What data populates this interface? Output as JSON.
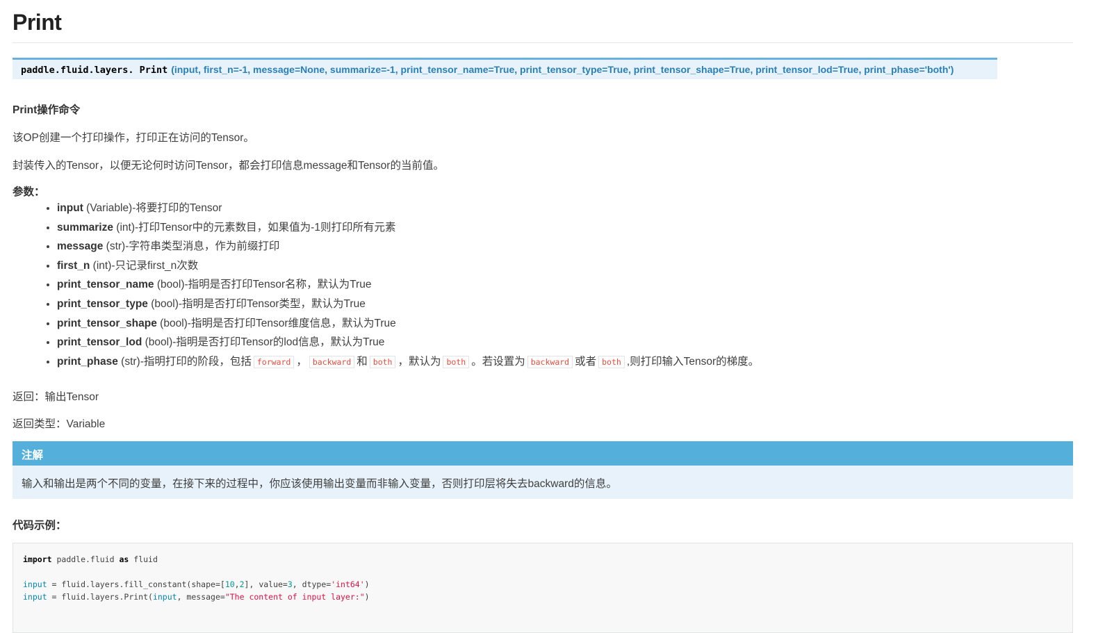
{
  "title": "Print",
  "signature": {
    "module": "paddle.fluid.layers.",
    "function": "Print",
    "params": "(input, first_n=-1, message=None, summarize=-1, print_tensor_name=True, print_tensor_type=True, print_tensor_shape=True, print_tensor_lod=True, print_phase='both')"
  },
  "heading": "Print操作命令",
  "desc1": "该OP创建一个打印操作，打印正在访问的Tensor。",
  "desc2": "封装传入的Tensor，以便无论何时访问Tensor，都会打印信息message和Tensor的当前值。",
  "params_label": "参数：",
  "params": [
    {
      "name": "input",
      "desc": " (Variable)-将要打印的Tensor"
    },
    {
      "name": "summarize",
      "desc": " (int)-打印Tensor中的元素数目，如果值为-1则打印所有元素"
    },
    {
      "name": "message",
      "desc": " (str)-字符串类型消息，作为前缀打印"
    },
    {
      "name": "first_n",
      "desc": " (int)-只记录first_n次数"
    },
    {
      "name": "print_tensor_name",
      "desc": " (bool)-指明是否打印Tensor名称，默认为True"
    },
    {
      "name": "print_tensor_type",
      "desc": " (bool)-指明是否打印Tensor类型，默认为True"
    },
    {
      "name": "print_tensor_shape",
      "desc": " (bool)-指明是否打印Tensor维度信息，默认为True"
    },
    {
      "name": "print_tensor_lod",
      "desc": " (bool)-指明是否打印Tensor的lod信息，默认为True"
    }
  ],
  "print_phase": {
    "name": "print_phase",
    "t1": " (str)-指明打印的阶段，包括",
    "c1": "forward",
    "t2": "，",
    "c2": "backward",
    "t3": "和",
    "c3": "both",
    "t4": "，默认为",
    "c4": "both",
    "t5": "。若设置为",
    "c5": "backward",
    "t6": "或者",
    "c6": "both",
    "t7": ",则打印输入Tensor的梯度。"
  },
  "returns_label": "返回：",
  "returns": "输出Tensor",
  "return_type_label": "返回类型：",
  "return_type": "Variable",
  "note": {
    "title": "注解",
    "body": "输入和输出是两个不同的变量，在接下来的过程中，你应该使用输出变量而非输入变量，否则打印层将失去backward的信息。"
  },
  "example_label": "代码示例：",
  "code": {
    "l1": {
      "kw1": "import",
      "mod": " paddle.fluid ",
      "kw2": "as",
      "alias": " fluid"
    },
    "l2": {
      "v": "input",
      "a": " = fluid.layers.fill_constant(shape=[",
      "n1": "10",
      "c": ",",
      "n2": "2",
      "b": "], value=",
      "n3": "3",
      "d": ", dtype=",
      "s": "'int64'",
      "e": ")"
    },
    "l3": {
      "v": "input",
      "a": " = fluid.layers.Print(",
      "v2": "input",
      "b": ", message=",
      "s": "\"The content of input layer:\"",
      "e": ")"
    }
  }
}
